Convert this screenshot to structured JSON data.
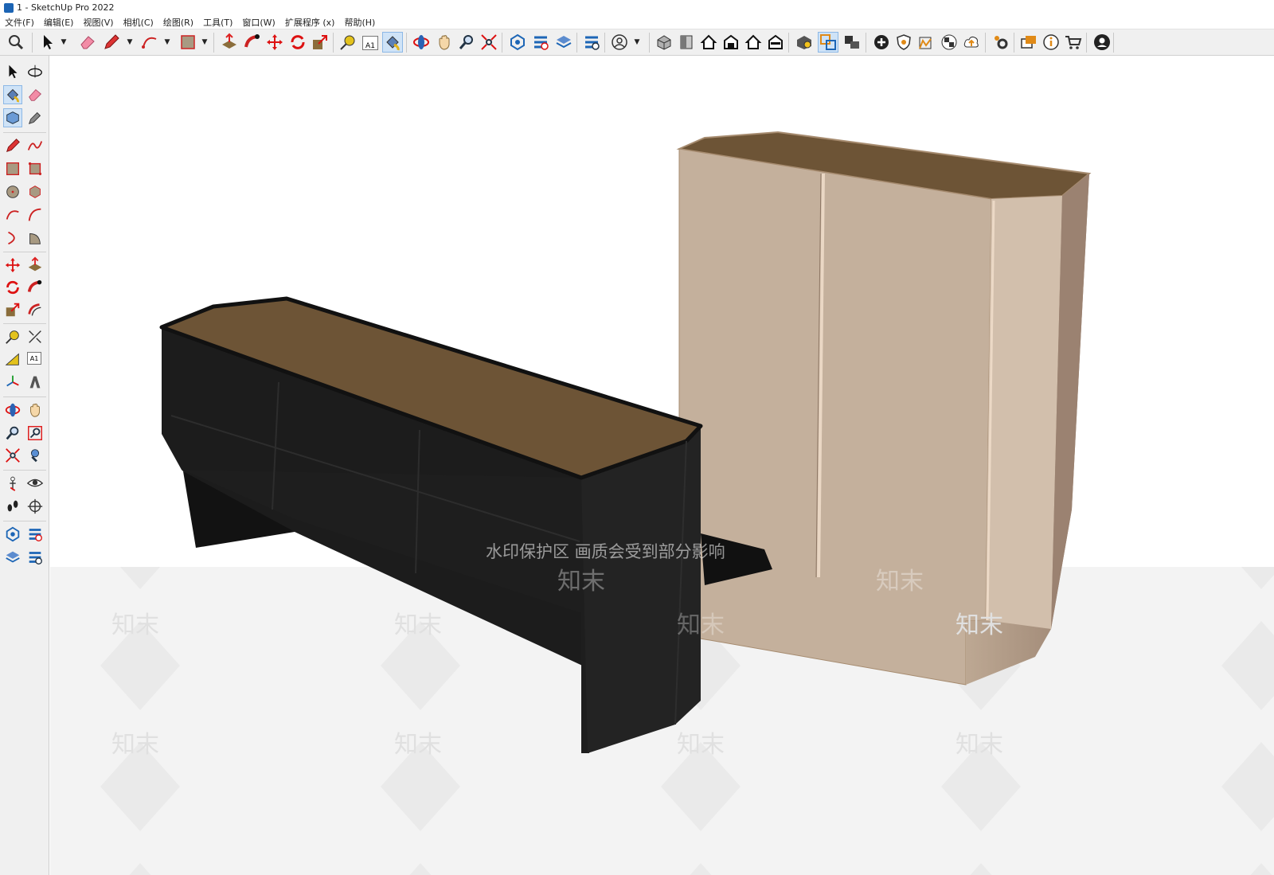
{
  "window": {
    "title": "1 - SketchUp Pro 2022"
  },
  "menu": [
    "文件(F)",
    "编辑(E)",
    "视图(V)",
    "相机(C)",
    "绘图(R)",
    "工具(T)",
    "窗口(W)",
    "扩展程序 (x)",
    "帮助(H)"
  ],
  "text_tool_label": "A1",
  "watermark": {
    "banner": "水印保护区   画质会受到部分影响",
    "logo": "知末"
  },
  "colors": {
    "cabinet_top": "#6d5436",
    "black_cabinet": "#1b1b1b",
    "wardrobe_front": "#c4b09c",
    "wardrobe_side": "#a88f7a",
    "ground": "#f3f3f3",
    "selected_tool": "#cfe3f7"
  }
}
